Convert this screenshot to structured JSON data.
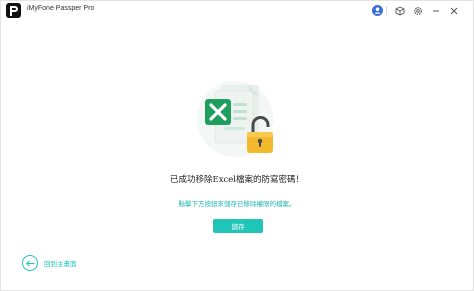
{
  "window": {
    "title": "iMyFone Passper Pro"
  },
  "titlebar": {
    "icons": [
      "user-icon",
      "cube-icon",
      "gear-icon",
      "minimize-icon",
      "close-icon"
    ]
  },
  "main": {
    "message": "已成功移除Excel檔案的防寫密碼！",
    "hint": "點擊下方按鈕來儲存已移除權限的檔案。",
    "save_label": "儲存",
    "back_label": "回到主畫面"
  },
  "colors": {
    "accent": "#20c5b8",
    "excel_green": "#1f9e5e",
    "lock_yellow": "#f5b92e"
  }
}
